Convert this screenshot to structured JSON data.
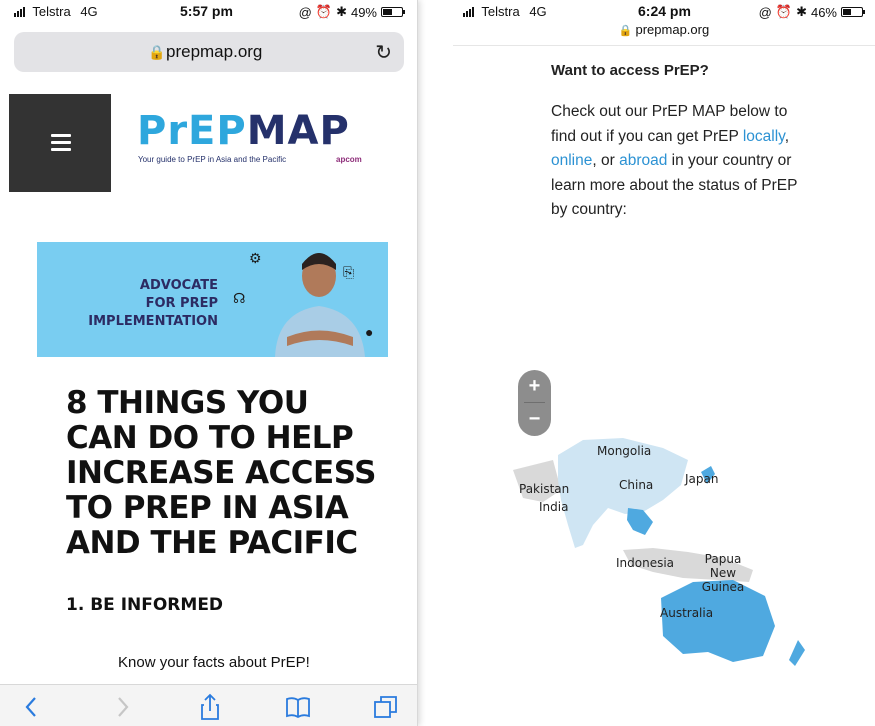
{
  "left_screen": {
    "status_bar": {
      "carrier": "Telstra",
      "network": "4G",
      "time": "5:57 pm",
      "battery": "49%",
      "battery_level": 0.49
    },
    "address_bar": {
      "url": "prepmap.org"
    },
    "logo": {
      "name_part1": "PrEP",
      "name_part2": "MAP",
      "tagline": "Your guide to PrEP in Asia and the Pacific",
      "partner": "apcom"
    },
    "banner": {
      "line1": "ADVOCATE",
      "line2": "FOR PREP",
      "line3": "IMPLEMENTATION"
    },
    "article": {
      "headline": "8 THINGS YOU CAN DO TO HELP INCREASE ACCESS TO PREP IN ASIA AND THE PACIFIC",
      "section_title": "1. BE INFORMED",
      "paragraph": "Know your facts about PrEP!"
    },
    "toolbar": {
      "icons": [
        "back-icon",
        "forward-icon",
        "share-icon",
        "bookmarks-icon",
        "tabs-icon"
      ]
    }
  },
  "right_screen": {
    "status_bar": {
      "carrier": "Telstra",
      "network": "4G",
      "time": "6:24 pm",
      "battery": "46%",
      "battery_level": 0.46
    },
    "address_bar": {
      "url": "prepmap.org"
    },
    "heading": "Want to access PrEP?",
    "intro": {
      "p1": "Check out our PrEP MAP below to find out if you can get PrEP ",
      "link_locally": "locally",
      "sep1": ", ",
      "link_online": "online",
      "p2": ", or ",
      "link_abroad": "abroad",
      "p3": " in your country or learn more about the status of PrEP by country:"
    },
    "map": {
      "zoom_in": "+",
      "zoom_out": "−",
      "labels": [
        "Mongolia",
        "Japan",
        "Pakistan",
        "China",
        "India",
        "Indonesia",
        "Papua New Guinea",
        "Australia"
      ]
    }
  },
  "colors": {
    "brand_blue": "#2ea7dd",
    "brand_navy": "#25316b",
    "banner_bg": "#79cdf1",
    "link": "#2c92d3",
    "map_highlight": "#4fa9e0",
    "map_light": "#cfe5f3",
    "map_grey": "#d9d9d9"
  }
}
